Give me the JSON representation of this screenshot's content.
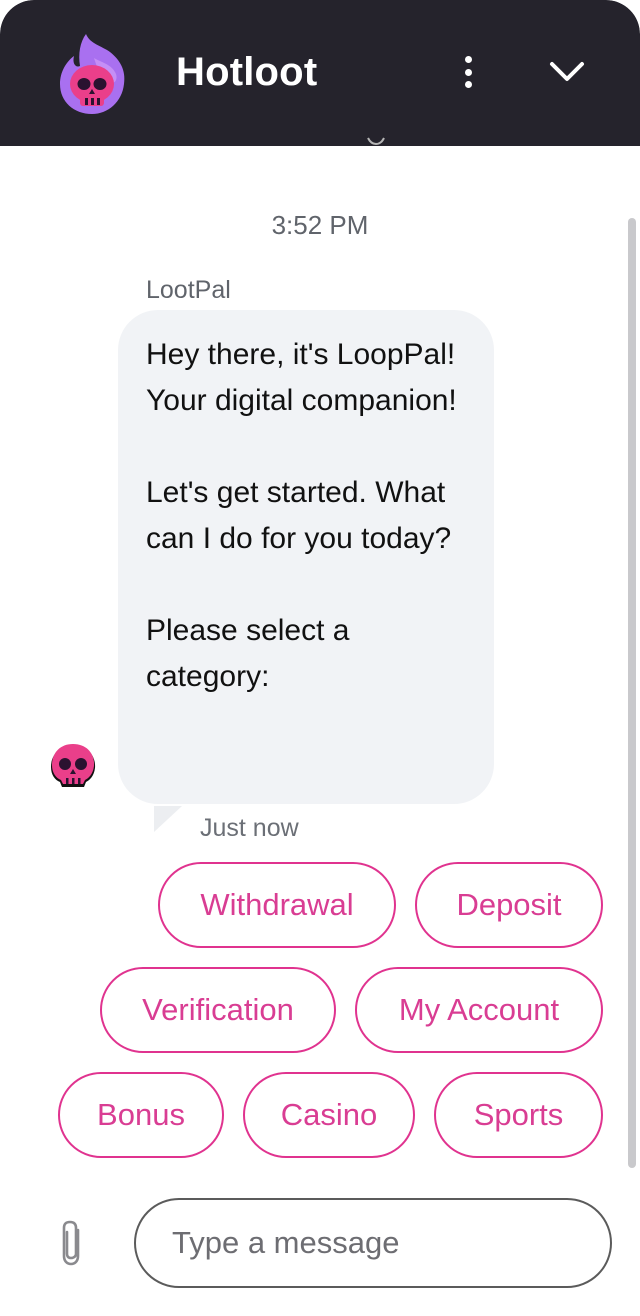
{
  "header": {
    "title": "Hotloot",
    "logo_icon": "flaming-skull-icon",
    "menu_icon": "more-vertical-icon",
    "collapse_icon": "chevron-down-icon",
    "background_color": "#25232c"
  },
  "conversation": {
    "timestamp": "3:52 PM",
    "message": {
      "sender": "LootPal",
      "avatar_icon": "skull-avatar-icon",
      "text": "Hey there, it's LoopPal! Your digital companion!\n\nLet's get started. What can I do for you today?\n\nPlease select a category:",
      "meta": "Just now"
    },
    "quick_replies": [
      "Withdrawal",
      "Deposit",
      "Verification",
      "My Account",
      "Bonus",
      "Casino",
      "Sports"
    ]
  },
  "composer": {
    "placeholder": "Type a message",
    "value": "",
    "attach_icon": "paperclip-icon"
  },
  "colors": {
    "accent": "#e0338f",
    "bubble": "#f1f3f6",
    "brand_purple": "#a970f0",
    "brand_pink": "#ea3f8a"
  }
}
